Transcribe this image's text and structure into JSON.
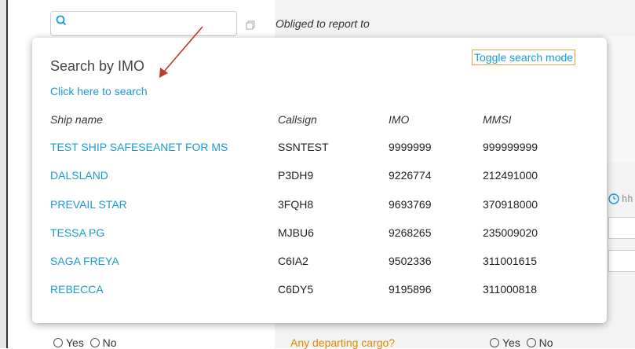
{
  "background": {
    "obliged_label": "Obliged to report to",
    "time_placeholder": "hh",
    "departing_label": "Any departing cargo?",
    "radio_yes": "Yes",
    "radio_no": "No"
  },
  "popup": {
    "title": "Search by IMO",
    "toggle_label": "Toggle search mode",
    "click_here": "Click here to search",
    "headers": {
      "ship": "Ship name",
      "callsign": "Callsign",
      "imo": "IMO",
      "mmsi": "MMSI"
    },
    "rows": [
      {
        "ship": "TEST SHIP SAFESEANET FOR MS",
        "callsign": "SSNTEST",
        "imo": "9999999",
        "mmsi": "999999999"
      },
      {
        "ship": "DALSLAND",
        "callsign": "P3DH9",
        "imo": "9226774",
        "mmsi": "212491000"
      },
      {
        "ship": "PREVAIL STAR",
        "callsign": "3FQH8",
        "imo": "9693769",
        "mmsi": "370918000"
      },
      {
        "ship": "TESSA PG",
        "callsign": "MJBU6",
        "imo": "9268265",
        "mmsi": "235009020"
      },
      {
        "ship": "SAGA FREYA",
        "callsign": "C6IA2",
        "imo": "9502336",
        "mmsi": "311001615"
      },
      {
        "ship": "REBECCA",
        "callsign": "C6DY5",
        "imo": "9195896",
        "mmsi": "311000818"
      }
    ]
  },
  "colors": {
    "link": "#1a9ad6",
    "accent_border": "#f0a040",
    "arrow": "#c0392b",
    "departing": "#e08a00"
  }
}
